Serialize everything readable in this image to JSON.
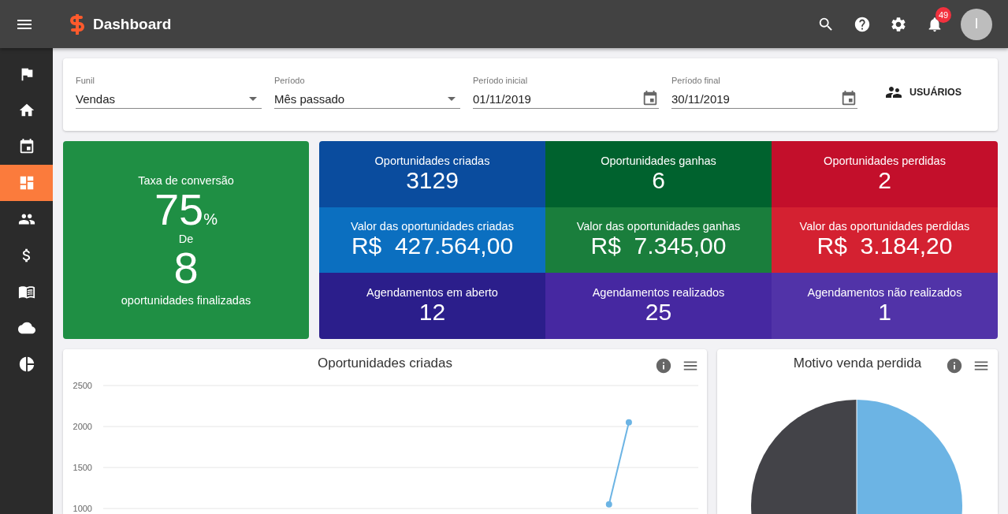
{
  "topbar": {
    "title": "Dashboard",
    "notifications_badge": "49",
    "avatar_letter": "I"
  },
  "sidebar": {
    "items": [
      {
        "selected": false
      },
      {
        "selected": false
      },
      {
        "selected": false
      },
      {
        "selected": true
      },
      {
        "selected": false
      },
      {
        "selected": false
      },
      {
        "selected": false
      },
      {
        "selected": false
      },
      {
        "selected": false
      }
    ]
  },
  "filters": [
    {
      "kind": "select",
      "label": "Funil",
      "value": "Vendas"
    },
    {
      "kind": "select",
      "label": "Período",
      "value": "Mês passado"
    },
    {
      "kind": "date",
      "label": "Período inicial",
      "value": "01/11/2019"
    },
    {
      "kind": "date",
      "label": "Período final",
      "value": "30/11/2019"
    }
  ],
  "users_button": "USUÁRIOS",
  "conversion": {
    "title": "Taxa de conversão",
    "value": "75",
    "unit": "%",
    "connector": "De",
    "count": "8",
    "caption": "oportunidades finalizadas"
  },
  "stats": [
    {
      "label": "Oportunidades criadas",
      "value": "3129",
      "color": "#0a4c9e"
    },
    {
      "label": "Oportunidades ganhas",
      "value": "6",
      "color": "#00622e"
    },
    {
      "label": "Oportunidades perdidas",
      "value": "2",
      "color": "#c30f2b"
    },
    {
      "label": "Valor das oportunidades criadas",
      "value": "R$  427.564,00",
      "color": "#0b6fc0"
    },
    {
      "label": "Valor das oportunidades ganhas",
      "value": "R$  7.345,00",
      "color": "#1a7e3c"
    },
    {
      "label": "Valor das oportunidades perdidas",
      "value": "R$  3.184,20",
      "color": "#d42131"
    },
    {
      "label": "Agendamentos em aberto",
      "value": "12",
      "color": "#2b1e8b"
    },
    {
      "label": "Agendamentos realizados",
      "value": "25",
      "color": "#4628a1"
    },
    {
      "label": "Agendamentos não realizados",
      "value": "1",
      "color": "#5133a8"
    }
  ],
  "line_chart": {
    "title": "Oportunidades criadas",
    "chart_data": {
      "type": "line",
      "grid": true,
      "ylim": [
        1000,
        2500
      ],
      "yticks": [
        1000,
        1500,
        2000,
        2500
      ],
      "series": [
        {
          "color": "#6cb4e4",
          "marker": true,
          "values": [
            null,
            null,
            null,
            null,
            null,
            null,
            null,
            null,
            null,
            null,
            null,
            null,
            null,
            null,
            null,
            null,
            null,
            null,
            null,
            null,
            null,
            null,
            null,
            null,
            null,
            1050,
            2050,
            null,
            null,
            null
          ]
        }
      ]
    }
  },
  "pie_chart": {
    "title": "Motivo venda perdida"
  }
}
